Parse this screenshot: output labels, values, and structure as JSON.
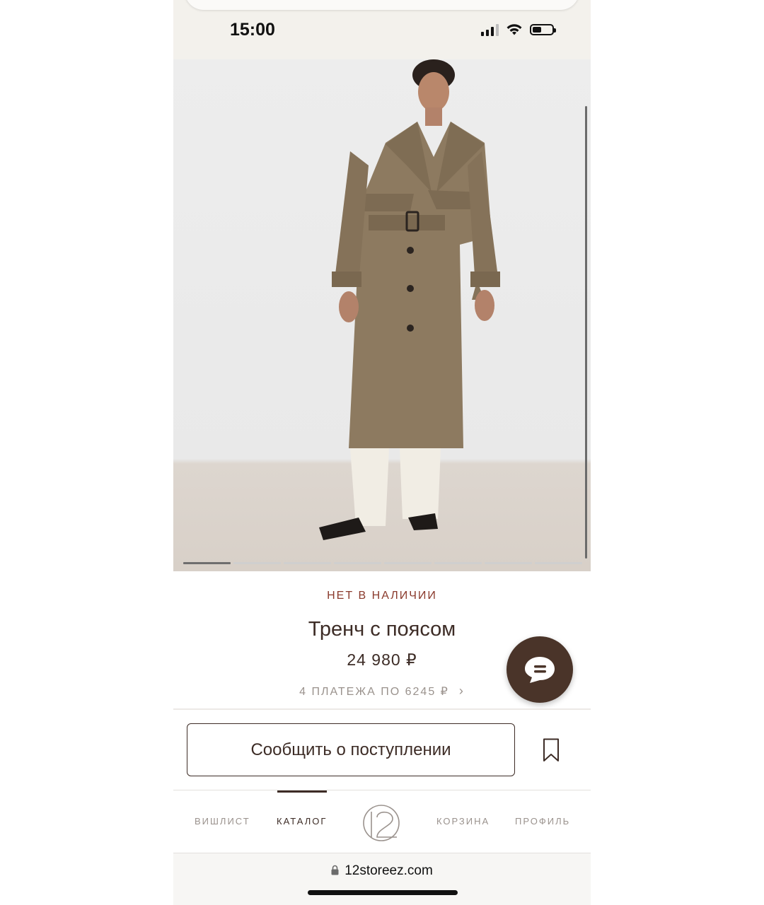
{
  "status_bar": {
    "time": "15:00"
  },
  "product": {
    "availability": "НЕТ В НАЛИЧИИ",
    "title": "Тренч с поясом",
    "price": "24 980 ₽",
    "installments": "4 ПЛАТЕЖА ПО 6245 ₽",
    "image_count": 8,
    "active_image": 1
  },
  "actions": {
    "notify_label": "Сообщить о поступлении"
  },
  "tabbar": {
    "wishlist": "ВИШЛИСТ",
    "catalog": "КАТАЛОГ",
    "cart": "КОРЗИНА",
    "profile": "ПРОФИЛЬ",
    "active": "catalog"
  },
  "browser": {
    "url": "12storeez.com"
  },
  "colors": {
    "brand_brown": "#3d2c26",
    "out_of_stock_red": "#8a3a2c",
    "chat_fab": "#4a3429"
  }
}
